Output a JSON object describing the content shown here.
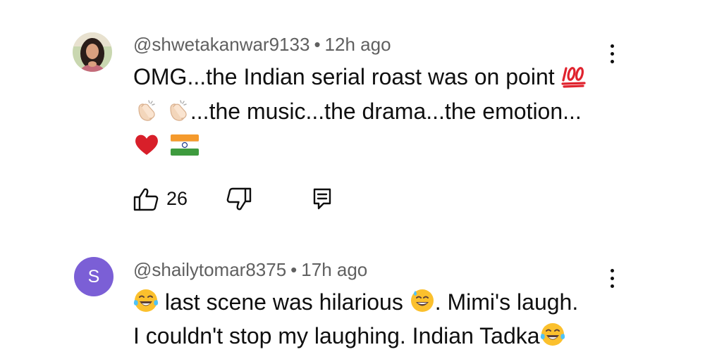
{
  "comments": [
    {
      "handle": "@shwetakanwar9133",
      "separator": "•",
      "time": "12h ago",
      "lines": [
        "OMG...the Indian serial roast was on point",
        "...the music...the drama...the emotion..."
      ],
      "like_count": "26",
      "avatar_icon": "profile-photo"
    },
    {
      "handle": "@shailytomar8375",
      "separator": "•",
      "time": "17h ago",
      "avatar_letter": "S",
      "avatar_color": "#7b5fd6",
      "line1_a": "last scene was hilarious",
      "line1_b": ". Mimi's laugh.",
      "line2": "I couldn't stop my laughing. Indian Tadka"
    }
  ],
  "icons": {
    "like": "thumbs-up-icon",
    "dislike": "thumbs-down-icon",
    "reply": "reply-icon",
    "more": "more-vertical-icon"
  }
}
